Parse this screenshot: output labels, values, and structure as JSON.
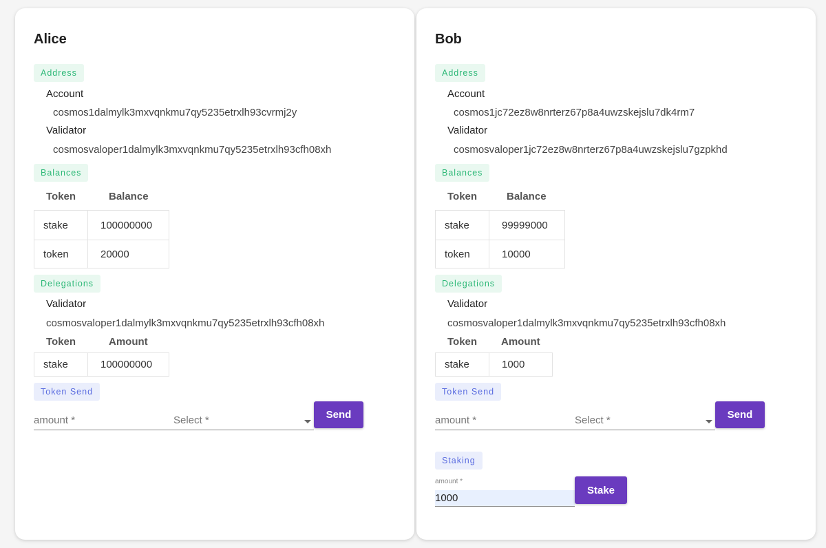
{
  "alice": {
    "name": "Alice",
    "address_chip": "Address",
    "account_label": "Account",
    "account": "cosmos1dalmylk3mxvqnkmu7qy5235etrxlh93cvrmj2y",
    "validator_label": "Validator",
    "validator": "cosmosvaloper1dalmylk3mxvqnkmu7qy5235etrxlh93cfh08xh",
    "balances_chip": "Balances",
    "balances_headers": [
      "Token",
      "Balance"
    ],
    "balances": [
      {
        "token": "stake",
        "balance": "100000000"
      },
      {
        "token": "token",
        "balance": "20000"
      }
    ],
    "delegations_chip": "Delegations",
    "deleg_validator_label": "Validator",
    "deleg_validator": "cosmosvaloper1dalmylk3mxvqnkmu7qy5235etrxlh93cfh08xh",
    "delegations_headers": [
      "Token",
      "Amount"
    ],
    "delegations": [
      {
        "token": "stake",
        "amount": "100000000"
      }
    ],
    "send_chip": "Token Send",
    "amount_placeholder": "amount *",
    "select_placeholder": "Select *",
    "send_button": "Send"
  },
  "bob": {
    "name": "Bob",
    "address_chip": "Address",
    "account_label": "Account",
    "account": "cosmos1jc72ez8w8nrterz67p8a4uwzskejslu7dk4rm7",
    "validator_label": "Validator",
    "validator": "cosmosvaloper1jc72ez8w8nrterz67p8a4uwzskejslu7gzpkhd",
    "balances_chip": "Balances",
    "balances_headers": [
      "Token",
      "Balance"
    ],
    "balances": [
      {
        "token": "stake",
        "balance": "99999000"
      },
      {
        "token": "token",
        "balance": "10000"
      }
    ],
    "delegations_chip": "Delegations",
    "deleg_validator_label": "Validator",
    "deleg_validator": "cosmosvaloper1dalmylk3mxvqnkmu7qy5235etrxlh93cfh08xh",
    "delegations_headers": [
      "Token",
      "Amount"
    ],
    "delegations": [
      {
        "token": "stake",
        "amount": "1000"
      }
    ],
    "send_chip": "Token Send",
    "amount_placeholder": "amount *",
    "select_placeholder": "Select *",
    "send_button": "Send",
    "staking_chip": "Staking",
    "stake_amount_label": "amount *",
    "stake_amount_value": "1000",
    "stake_button": "Stake"
  },
  "colors": {
    "button": "#6a3bbf",
    "green_chip_bg": "#e9f8f0",
    "green_chip_text": "#2db877",
    "blue_chip_bg": "#eaeefc",
    "blue_chip_text": "#5b6de0"
  }
}
